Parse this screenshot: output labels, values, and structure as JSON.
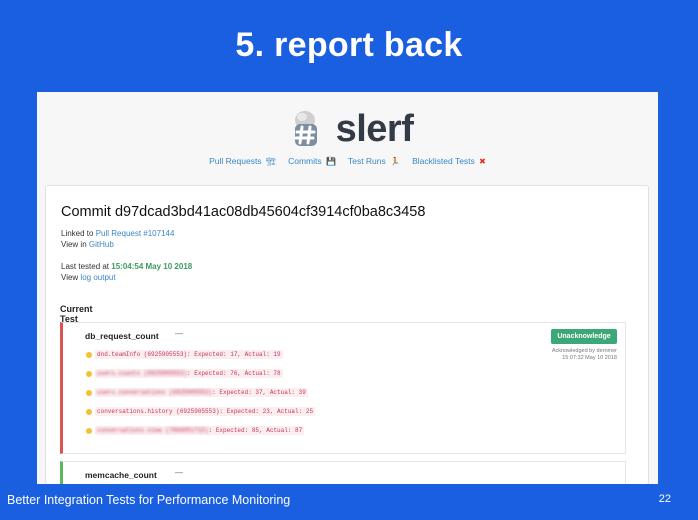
{
  "slide": {
    "title": "5. report back",
    "footer_title": "Better Integration Tests for Performance Monitoring",
    "page_number": "22"
  },
  "app": {
    "logo_text": "slerf",
    "nav": [
      {
        "label": "Pull Requests",
        "icon": "construction-icon"
      },
      {
        "label": "Commits",
        "icon": "floppy-disk-icon"
      },
      {
        "label": "Test Runs",
        "icon": "runner-icon"
      },
      {
        "label": "Blacklisted Tests",
        "icon": "red-x-icon"
      }
    ]
  },
  "commit": {
    "title": "Commit d97dcad3bd41ac08db45604cf3914cf0ba8c3458",
    "linked_prefix": "Linked to ",
    "linked_link": "Pull Request #107144",
    "view_prefix": "View in ",
    "view_link": "GitHub",
    "last_tested_prefix": "Last tested at ",
    "last_tested_value": "15:04:54 May 10 2018",
    "log_prefix": "View ",
    "log_link": "log output"
  },
  "results": {
    "section_title": "Current Test Results",
    "tests": [
      {
        "name": "db_request_count",
        "dash": "—",
        "ack_button": "Unacknowledge",
        "ack_by": "Acknowledged by dernmer",
        "ack_time": "15:07:32 May 10 2018",
        "rows": [
          {
            "name": "dnd.teamInfo (6925905553)",
            "detail": "Expected: 17, Actual: 19",
            "blurred": false
          },
          {
            "name": "users.counts (6925905553)",
            "detail": "Expected: 76, Actual: 78",
            "blurred": true
          },
          {
            "name": "users.conversations (6925905553)",
            "detail": "Expected: 37, Actual: 39",
            "blurred": true
          },
          {
            "name": "conversations.history (6925905553)",
            "detail": "Expected: 23, Actual: 25",
            "blurred": false
          },
          {
            "name": "conversations.view (7866051715)",
            "detail": "Expected: 85, Actual: 87",
            "blurred": true
          }
        ]
      },
      {
        "name": "memcache_count",
        "dash": "—"
      }
    ]
  }
}
